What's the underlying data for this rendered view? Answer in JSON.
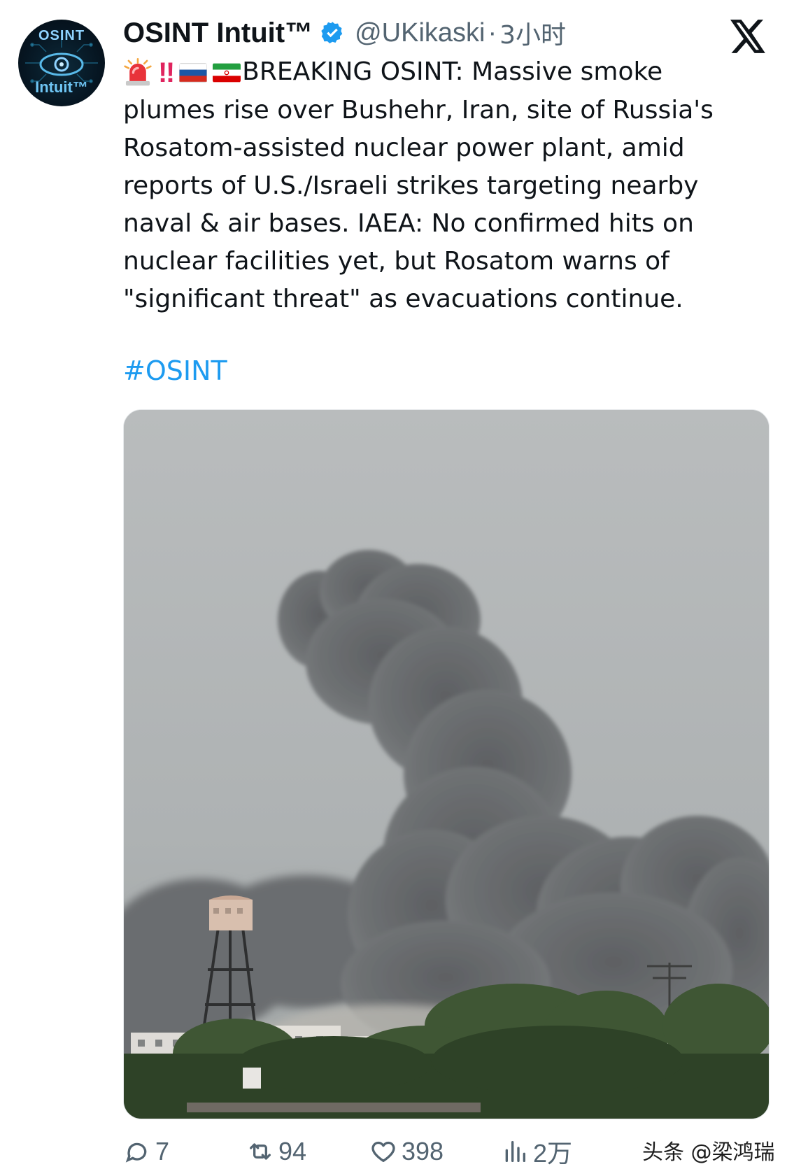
{
  "author": {
    "name": "OSINT Intuit™",
    "handle": "@UKikaski",
    "separator": "·",
    "time": "3小时",
    "avatar_text_top": "OSINT",
    "avatar_text_bottom": "Intuit™"
  },
  "tweet": {
    "lead_emojis": [
      "siren-emoji",
      "double-exclamation-emoji",
      "russia-flag-emoji",
      "iran-flag-emoji"
    ],
    "exclaim": "‼",
    "text": "BREAKING OSINT: Massive smoke plumes rise over Bushehr, Iran, site of Russia's Rosatom-assisted nuclear power plant, amid reports of U.S./Israeli strikes targeting nearby naval & air bases. IAEA: No confirmed hits on nuclear facilities yet, but Rosatom warns of \"significant threat\" as evacuations continue.",
    "hashtag": "#OSINT"
  },
  "media": {
    "icon": "photo-smoke-plume"
  },
  "actions": {
    "replies": "7",
    "reposts": "94",
    "likes": "398",
    "views": "2万"
  },
  "watermark": "头条 @梁鸿瑞",
  "colors": {
    "text": "#0f1419",
    "muted": "#536471",
    "link": "#1d9bf0",
    "verified": "#1d9bf0"
  }
}
